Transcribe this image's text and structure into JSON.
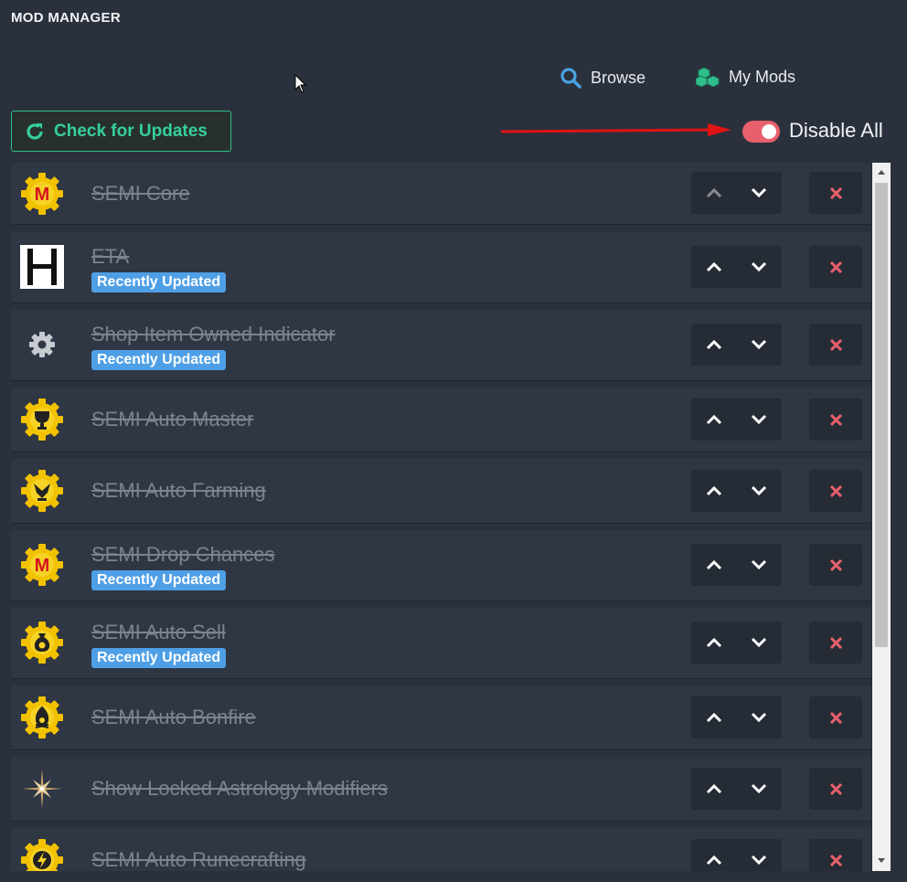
{
  "window": {
    "title": "MOD MANAGER"
  },
  "nav": {
    "browse": {
      "label": "Browse",
      "icon": "search-icon"
    },
    "mymods": {
      "label": "My Mods",
      "icon": "cubes-icon"
    }
  },
  "toolbar": {
    "check_updates_label": "Check for Updates",
    "disable_all_label": "Disable All",
    "disable_all_on": true
  },
  "colors": {
    "accent_green": "#35d09a",
    "toggle_on": "#e8606b",
    "badge_blue": "#4e9fe6",
    "delete_red": "#e5606b",
    "annotation_arrow": "#e11414"
  },
  "mods": [
    {
      "name": "SEMI Core",
      "badge": "",
      "icon": "semi-m-icon"
    },
    {
      "name": "ETA",
      "badge": "Recently Updated",
      "icon": "eta-h-icon"
    },
    {
      "name": "Shop Item Owned Indicator",
      "badge": "Recently Updated",
      "icon": "gear-icon"
    },
    {
      "name": "SEMI Auto Master",
      "badge": "",
      "icon": "trophy-gear-icon"
    },
    {
      "name": "SEMI Auto Farming",
      "badge": "",
      "icon": "farming-gear-icon"
    },
    {
      "name": "SEMI Drop Chances",
      "badge": "Recently Updated",
      "icon": "semi-m-icon"
    },
    {
      "name": "SEMI Auto Sell",
      "badge": "Recently Updated",
      "icon": "coin-bag-gear-icon"
    },
    {
      "name": "SEMI Auto Bonfire",
      "badge": "",
      "icon": "bonfire-gear-icon"
    },
    {
      "name": "Show Locked Astrology Modifiers",
      "badge": "",
      "icon": "star-sparkle-icon"
    },
    {
      "name": "SEMI Auto Runecrafting",
      "badge": "",
      "icon": "rune-gear-icon"
    }
  ]
}
